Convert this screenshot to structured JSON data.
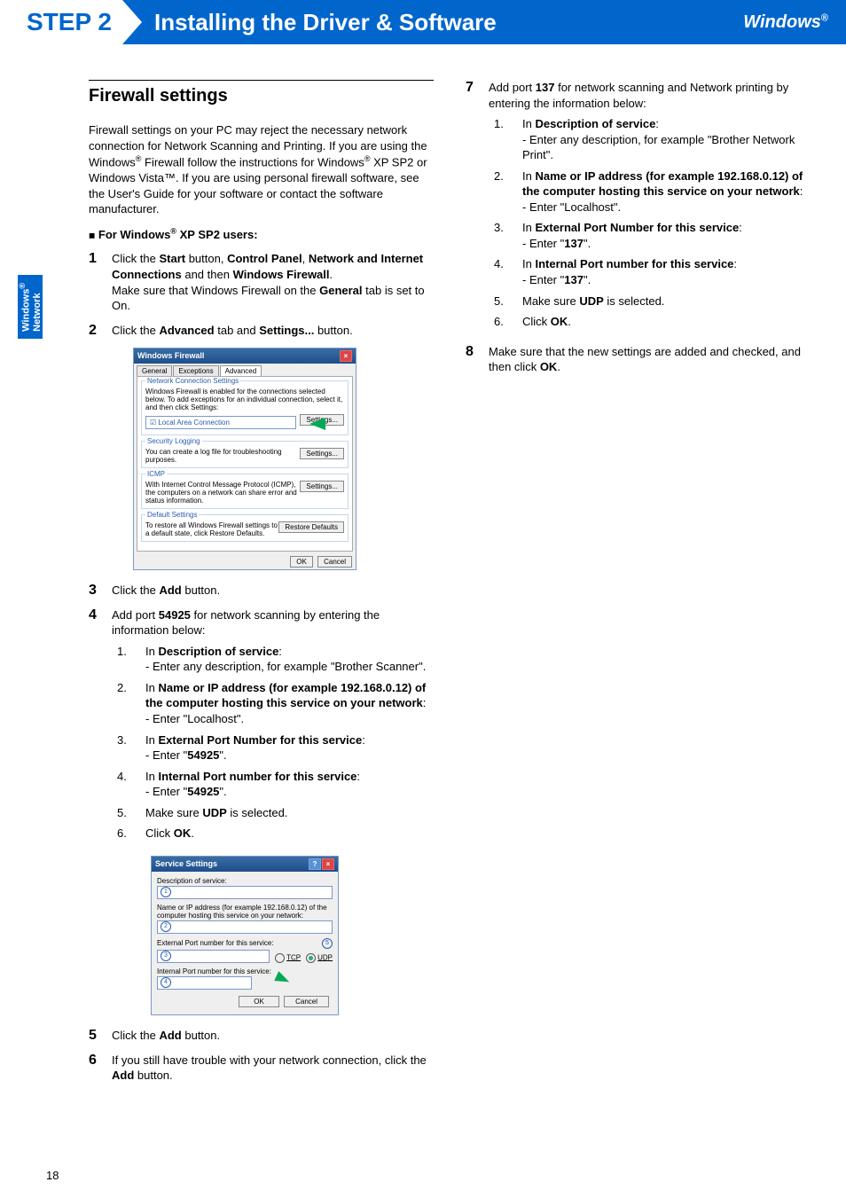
{
  "header": {
    "step": "STEP 2",
    "title": "Installing the Driver & Software",
    "rightLabel": "Windows",
    "rightSup": "®"
  },
  "sideTab": {
    "line1": "Windows",
    "sup": "®",
    "line2": "Network"
  },
  "sectionTitle": "Firewall settings",
  "intro": "Firewall settings on your PC may reject the necessary network connection for Network Scanning and Printing. If you are using the Windows® Firewall follow the instructions for Windows® XP SP2 or Windows Vista™. If you are using personal firewall software, see the User's Guide for your software or contact the software manufacturer.",
  "bulletLabel": "For Windows® XP SP2 users:",
  "step1": {
    "num": "1",
    "text": "Click the Start button, Control Panel, Network and Internet Connections and then Windows Firewall.",
    "text2": "Make sure that Windows Firewall on the General tab is set to On."
  },
  "step2": {
    "num": "2",
    "text": "Click the Advanced tab and Settings... button."
  },
  "fwDialog": {
    "title": "Windows Firewall",
    "tabs": [
      "General",
      "Exceptions",
      "Advanced"
    ],
    "netConnTitle": "Network Connection Settings",
    "netConnDesc": "Windows Firewall is enabled for the connections selected below. To add exceptions for an individual connection, select it, and then click Settings:",
    "lan": "Local Area Connection",
    "settingsBtn": "Settings...",
    "secLogTitle": "Security Logging",
    "secLogDesc": "You can create a log file for troubleshooting purposes.",
    "icmpTitle": "ICMP",
    "icmpDesc": "With Internet Control Message Protocol (ICMP), the computers on a network can share error and status information.",
    "defTitle": "Default Settings",
    "defDesc": "To restore all Windows Firewall settings to a default state, click Restore Defaults.",
    "restoreBtn": "Restore Defaults",
    "ok": "OK",
    "cancel": "Cancel"
  },
  "step3": {
    "num": "3",
    "text": "Click the Add button."
  },
  "step4": {
    "num": "4",
    "lead": "Add port 54925 for network scanning by entering the information below:",
    "items": [
      {
        "n": "1.",
        "label": "Description of service",
        "body": "- Enter any description, for example  \"Brother Scanner\"."
      },
      {
        "n": "2.",
        "label": "Name or IP address (for example 192.168.0.12) of the computer hosting this service on your network",
        "body": "- Enter \"Localhost\"."
      },
      {
        "n": "3.",
        "label": "External Port Number for this service",
        "body": "- Enter \"54925\"."
      },
      {
        "n": "4.",
        "label": "Internal Port number for this service",
        "body": "- Enter \"54925\"."
      },
      {
        "n": "5.",
        "plain": "Make sure UDP is selected."
      },
      {
        "n": "6.",
        "plain": "Click OK."
      }
    ]
  },
  "svcDialog": {
    "title": "Service Settings",
    "desc": "Description of service:",
    "name": "Name or IP address (for example 192.168.0.12) of the computer hosting this service on your network:",
    "ext": "External Port number for this service:",
    "intl": "Internal Port number for this service:",
    "tcp": "TCP",
    "udp": "UDP",
    "ok": "OK",
    "cancel": "Cancel"
  },
  "step5": {
    "num": "5",
    "text": "Click the Add button."
  },
  "step6": {
    "num": "6",
    "text": "If you still have trouble with your network connection, click the Add button."
  },
  "step7": {
    "num": "7",
    "lead": "Add port 137 for network scanning and Network printing by entering the information below:",
    "items": [
      {
        "n": "1.",
        "label": "Description of service",
        "body": "- Enter any description, for example \"Brother Network Print\"."
      },
      {
        "n": "2.",
        "label": "Name or IP address (for example 192.168.0.12) of the computer hosting this service on your network",
        "body": "- Enter \"Localhost\"."
      },
      {
        "n": "3.",
        "label": "External Port Number for this service",
        "body": "- Enter \"137\"."
      },
      {
        "n": "4.",
        "label": "Internal Port number for this service",
        "body": "- Enter \"137\"."
      },
      {
        "n": "5.",
        "plain": "Make sure UDP is selected."
      },
      {
        "n": "6.",
        "plain": "Click OK."
      }
    ]
  },
  "step8": {
    "num": "8",
    "text": "Make sure that the new settings are added and checked, and then click OK."
  },
  "pageNumber": "18"
}
